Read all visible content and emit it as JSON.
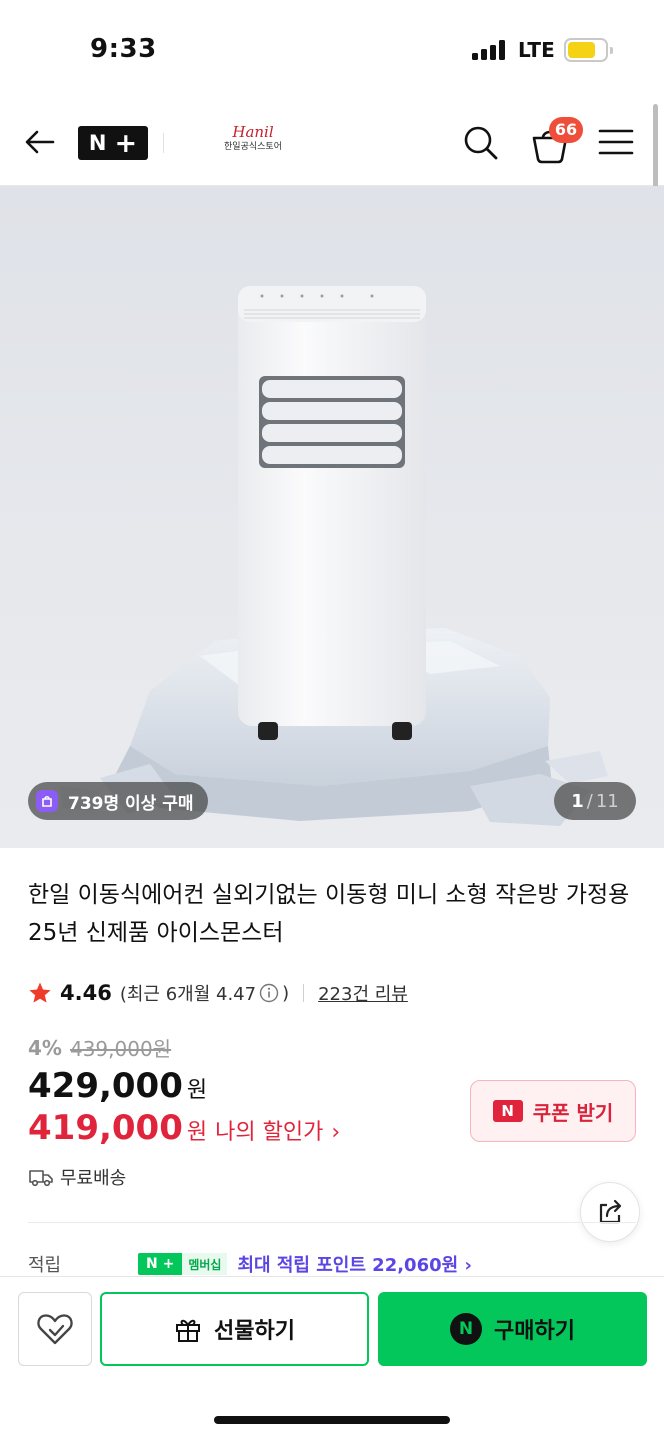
{
  "status_bar": {
    "time": "9:33",
    "network": "LTE"
  },
  "header": {
    "np_badge_n": "N",
    "np_badge_plus": "+",
    "store_logo_script": "Hanil",
    "store_name": "한일공식스토어",
    "cart_count": "66"
  },
  "hero": {
    "purchase_badge": "739명 이상 구매",
    "page_current": "1",
    "page_separator": "/",
    "page_total": "11"
  },
  "product": {
    "title": "한일 이동식에어컨 실외기없는 이동형 미니 소형 작은방 가정용 25년 신제품 아이스몬스터",
    "rating": "4.46",
    "recent_rating": "(최근 6개월 4.47",
    "recent_rating_close": ")",
    "review_count": "223건 리뷰",
    "discount_rate": "4%",
    "original_price": "439,000원",
    "price": "429,000",
    "price_unit": "원",
    "my_price": "419,000",
    "my_price_unit": "원",
    "my_price_label": "나의 할인가",
    "my_price_chevron": "›",
    "coupon_button": "쿠폰 받기",
    "coupon_icon_letter": "N",
    "shipping": "무료배송",
    "points_label": "적립",
    "points_badge_np": "N +",
    "points_badge_membership": "멤버십",
    "points_text": "최대 적립 포인트 22,060원 ›"
  },
  "bottom_bar": {
    "gift_button": "선물하기",
    "buy_button": "구매하기",
    "buy_icon_letter": "N"
  },
  "colors": {
    "naver_green": "#03c75a",
    "discount_red": "#e0243b",
    "cart_badge": "#ef4f3a",
    "points_purple": "#5b46e5"
  },
  "icons": [
    "back-arrow-icon",
    "search-icon",
    "shopping-basket-icon",
    "hamburger-menu-icon",
    "star-icon",
    "info-icon",
    "truck-icon",
    "share-icon",
    "heart-icon",
    "gift-icon",
    "naver-n-icon"
  ]
}
